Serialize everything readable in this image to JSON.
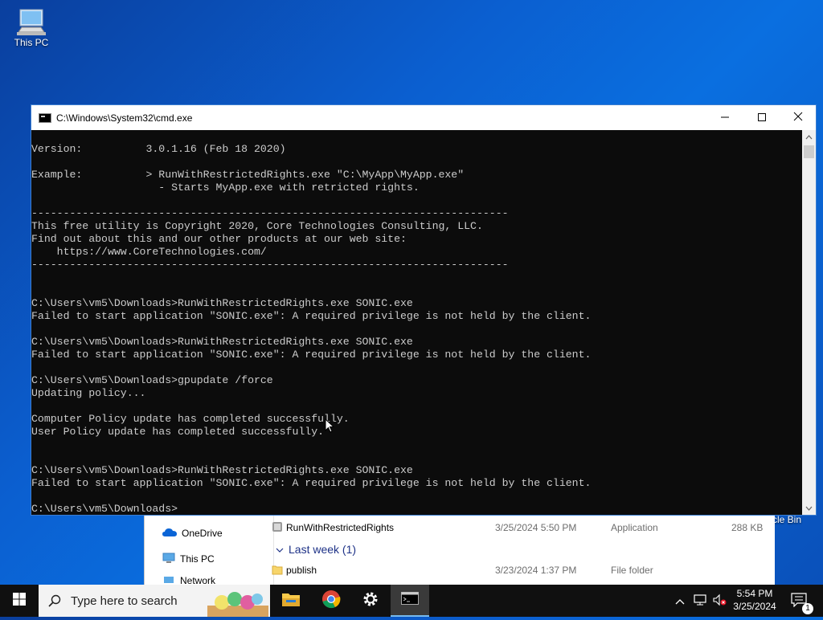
{
  "desktop": {
    "this_pc_label": "This PC",
    "recycle_bin_label": "ycle Bin"
  },
  "explorer": {
    "nav": [
      {
        "label": "OneDrive",
        "icon": "cloud-icon"
      },
      {
        "label": "This PC",
        "icon": "computer-icon"
      },
      {
        "label": "Network",
        "icon": "network-icon"
      }
    ],
    "group_header": "Last week (1)",
    "rows": [
      {
        "name": "RunWithRestrictedRights",
        "date": "3/25/2024 5:50 PM",
        "type": "Application",
        "size": "288 KB"
      },
      {
        "name": "publish",
        "date": "3/23/2024 1:37 PM",
        "type": "File folder",
        "size": ""
      }
    ]
  },
  "cmd": {
    "title": "C:\\Windows\\System32\\cmd.exe",
    "lines": [
      "",
      "Version:          3.0.1.16 (Feb 18 2020)",
      "",
      "Example:          > RunWithRestrictedRights.exe \"C:\\MyApp\\MyApp.exe\"",
      "                    - Starts MyApp.exe with retricted rights.",
      "",
      "---------------------------------------------------------------------------",
      "This free utility is Copyright 2020, Core Technologies Consulting, LLC.",
      "Find out about this and our other products at our web site:",
      "    https://www.CoreTechnologies.com/",
      "---------------------------------------------------------------------------",
      "",
      "",
      "C:\\Users\\vm5\\Downloads>RunWithRestrictedRights.exe SONIC.exe",
      "Failed to start application \"SONIC.exe\": A required privilege is not held by the client.",
      "",
      "C:\\Users\\vm5\\Downloads>RunWithRestrictedRights.exe SONIC.exe",
      "Failed to start application \"SONIC.exe\": A required privilege is not held by the client.",
      "",
      "C:\\Users\\vm5\\Downloads>gpupdate /force",
      "Updating policy...",
      "",
      "Computer Policy update has completed successfully.",
      "User Policy update has completed successfully.",
      "",
      "",
      "C:\\Users\\vm5\\Downloads>RunWithRestrictedRights.exe SONIC.exe",
      "Failed to start application \"SONIC.exe\": A required privilege is not held by the client.",
      "",
      "C:\\Users\\vm5\\Downloads>"
    ]
  },
  "taskbar": {
    "search_placeholder": "Type here to search",
    "time": "5:54 PM",
    "date": "3/25/2024",
    "notification_count": "1",
    "apps": [
      "file-explorer-icon",
      "chrome-icon",
      "settings-icon",
      "cmd-icon"
    ]
  },
  "colors": {
    "desktop_blue": "#0a5fd0",
    "console_text": "#cccccc",
    "console_bg": "#0c0c0c",
    "taskbar_bg": "#101010"
  }
}
